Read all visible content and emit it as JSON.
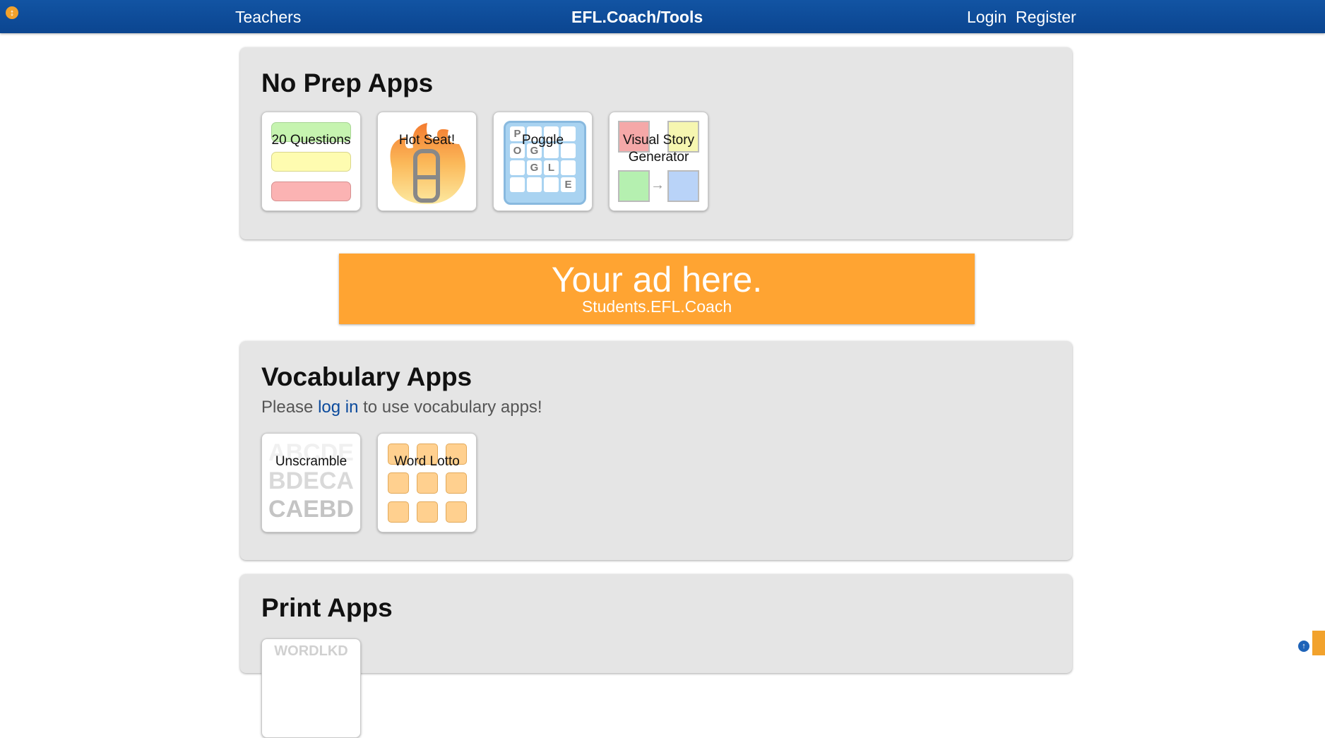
{
  "nav": {
    "teachers": "Teachers",
    "brand": "EFL.Coach/Tools",
    "login": "Login",
    "register": "Register"
  },
  "no_prep": {
    "title": "No Prep Apps",
    "apps": [
      "20 Questions",
      "Hot Seat!",
      "Poggle",
      "Visual Story Generator"
    ]
  },
  "ad": {
    "title": "Your ad here.",
    "subtitle": "Students.EFL.Coach"
  },
  "vocabulary": {
    "title": "Vocabulary Apps",
    "notice_prefix": "Please",
    "notice_link": "log in",
    "notice_suffix": "to use vocabulary apps!",
    "apps": [
      "Unscramble",
      "Word Lotto"
    ],
    "unscramble_rows": [
      "ABCDE",
      "BDECA",
      "CAEBD"
    ]
  },
  "print": {
    "title": "Print Apps",
    "partial_tile_text": "WORDLKD"
  },
  "poggle_letters": [
    "P",
    "O",
    "G",
    "G",
    "L",
    "E"
  ],
  "colors": {
    "nav": "#0b4590",
    "panel": "#e5e5e5",
    "ad": "#ffa432",
    "link": "#0b4a9c"
  }
}
